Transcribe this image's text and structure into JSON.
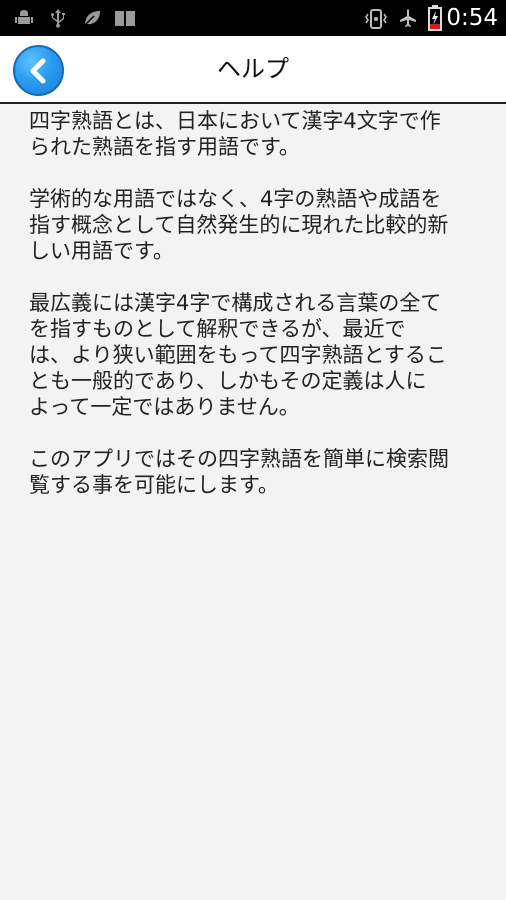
{
  "status_bar": {
    "left_icons": [
      "android-icon",
      "usb-icon",
      "leaf-icon",
      "book-icon"
    ],
    "right_icons": [
      "vibrate-icon",
      "airplane-icon",
      "battery-charging-icon"
    ],
    "time": "0:54"
  },
  "header": {
    "title": "ヘルプ",
    "back_icon": "chevron-left-icon",
    "accent_color": "#2a9cf0"
  },
  "content": {
    "paragraphs": [
      [
        "四字熟語とは、日本において漢字4文字で作",
        "られた熟語を指す用語です。"
      ],
      [
        "学術的な用語ではなく、4字の熟語や成語を",
        "指す概念として自然発生的に現れた比較的新",
        "しい用語です。"
      ],
      [
        "最広義には漢字4字で構成される言葉の全て",
        "を指すものとして解釈できるが、最近で",
        "は、より狭い範囲をもって四字熟語とするこ",
        "とも一般的であり、しかもその定義は人に",
        "よって一定ではありません。"
      ],
      [
        "このアプリではその四字熟語を簡単に検索閲",
        "覧する事を可能にします。"
      ]
    ]
  }
}
